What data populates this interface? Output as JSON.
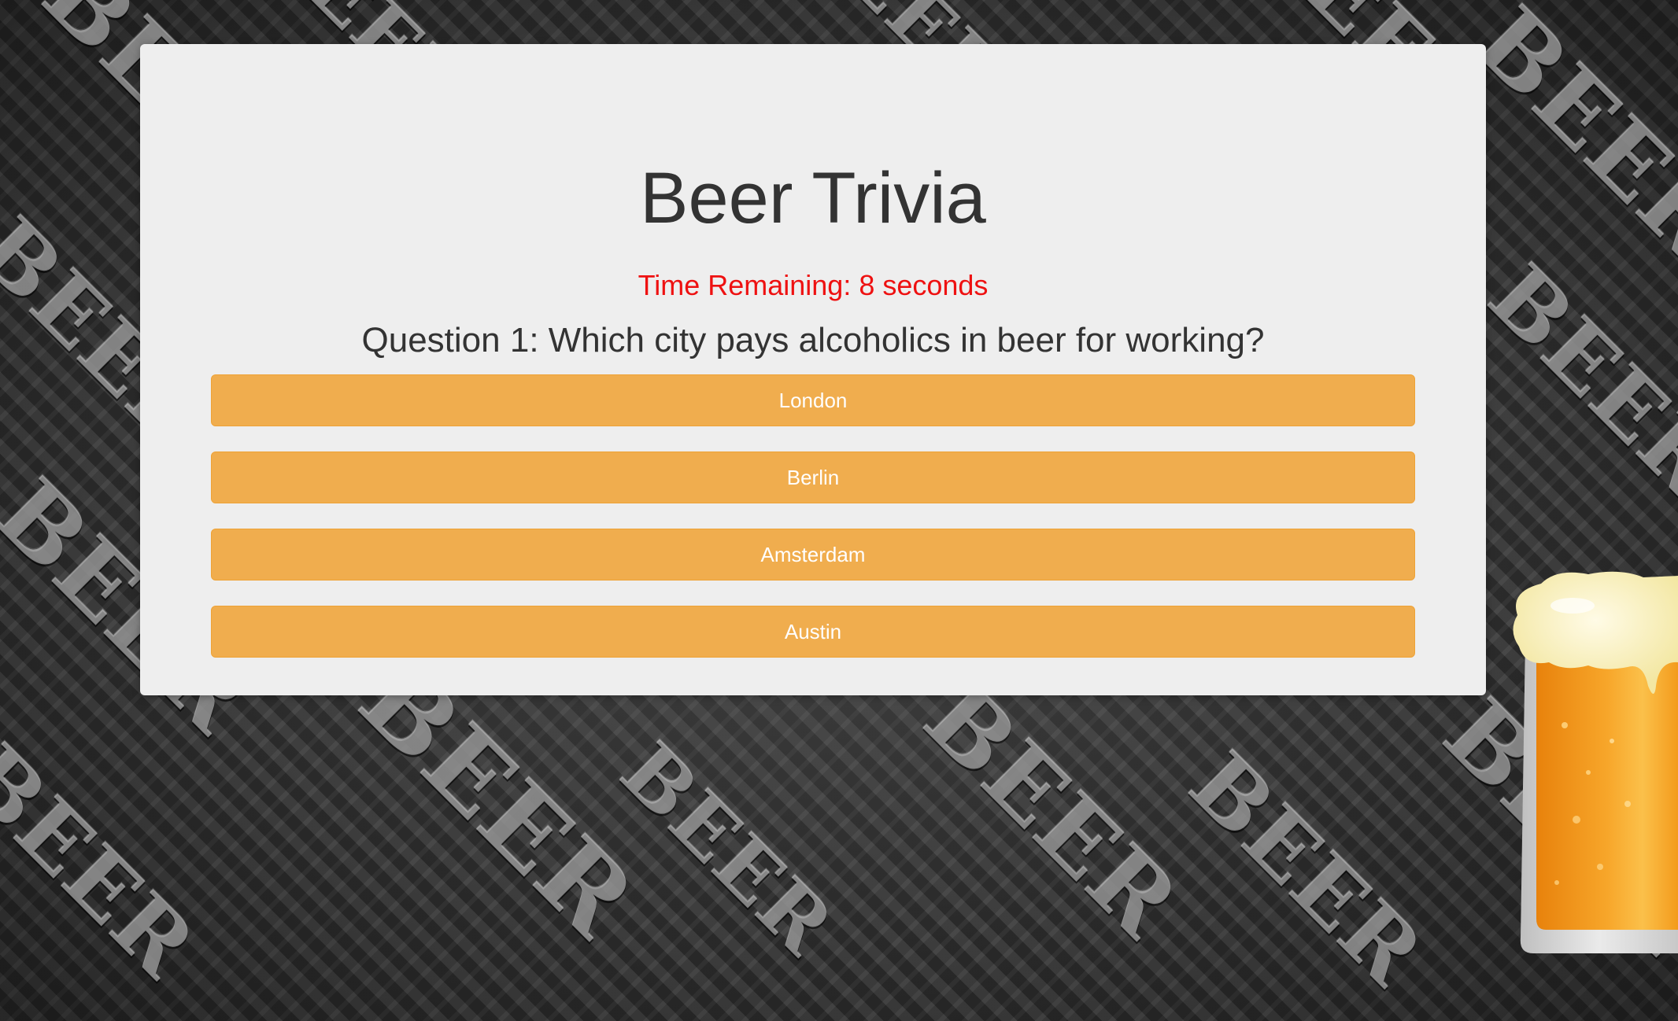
{
  "app": {
    "title": "Beer Trivia"
  },
  "timer": {
    "text": "Time Remaining: 8 seconds"
  },
  "question": {
    "text": "Question 1: Which city pays alcoholics in beer for working?"
  },
  "answers": [
    {
      "label": "London"
    },
    {
      "label": "Berlin"
    },
    {
      "label": "Amsterdam"
    },
    {
      "label": "Austin"
    }
  ],
  "colors": {
    "card_background": "#eeeeee",
    "button_background": "#f0ad4e",
    "button_text": "#ffffff",
    "timer_text": "#ee1111",
    "title_text": "#333333"
  },
  "icons": {
    "decoration": "beer-mug-icon"
  }
}
